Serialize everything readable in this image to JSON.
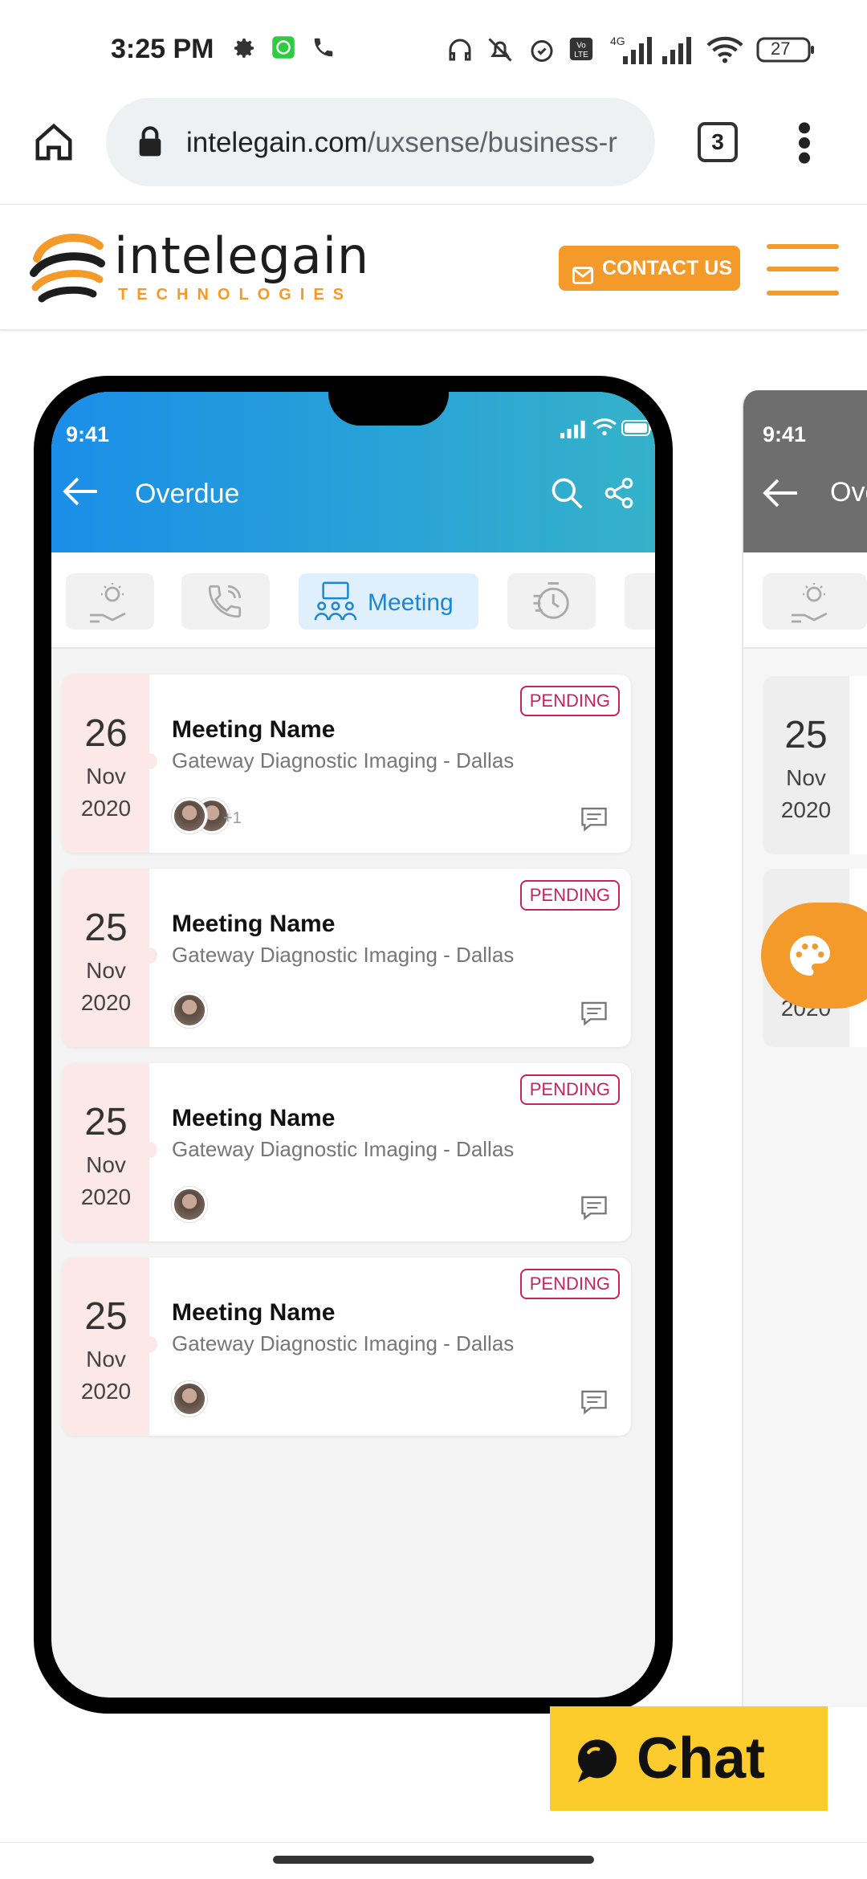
{
  "status_bar": {
    "time": "3:25 PM",
    "battery": "27",
    "network": "4G",
    "icons": [
      "gear-icon",
      "whatsapp-icon",
      "phone-icon",
      "headphones-icon",
      "mute-icon",
      "alarm-icon",
      "volte-icon",
      "signal-icon",
      "signal-icon",
      "wifi-icon",
      "battery-icon"
    ]
  },
  "browser": {
    "url_domain": "intelegain.com",
    "url_path": "/uxsense/business-r",
    "tab_count": "3"
  },
  "site_header": {
    "logo_main": "intelegain",
    "logo_sub": "TECHNOLOGIES",
    "contact_label": "CONTACT US",
    "brand_color": "#f39a2a"
  },
  "phone_mock": {
    "time": "9:41",
    "title": "Overdue",
    "active_filter": "Meeting",
    "filters": [
      "idea-icon",
      "call-icon",
      "meeting-icon",
      "history-icon"
    ],
    "cards": [
      {
        "day": "26",
        "month": "Nov",
        "year": "2020",
        "title": "Meeting Name",
        "subtitle": "Gateway Diagnostic Imaging - Dallas",
        "status": "PENDING",
        "extra": "+1"
      },
      {
        "day": "25",
        "month": "Nov",
        "year": "2020",
        "title": "Meeting Name",
        "subtitle": "Gateway Diagnostic Imaging - Dallas",
        "status": "PENDING",
        "extra": ""
      },
      {
        "day": "25",
        "month": "Nov",
        "year": "2020",
        "title": "Meeting Name",
        "subtitle": "Gateway Diagnostic Imaging - Dallas",
        "status": "PENDING",
        "extra": ""
      },
      {
        "day": "25",
        "month": "Nov",
        "year": "2020",
        "title": "Meeting Name",
        "subtitle": "Gateway Diagnostic Imaging - Dallas",
        "status": "PENDING",
        "extra": ""
      }
    ]
  },
  "phone_mock_2": {
    "time": "9:41",
    "title": "Ove",
    "cards": [
      {
        "day": "25",
        "month": "Nov",
        "year": "2020"
      },
      {
        "year": "2020"
      }
    ]
  },
  "chat": {
    "label": "Chat"
  }
}
